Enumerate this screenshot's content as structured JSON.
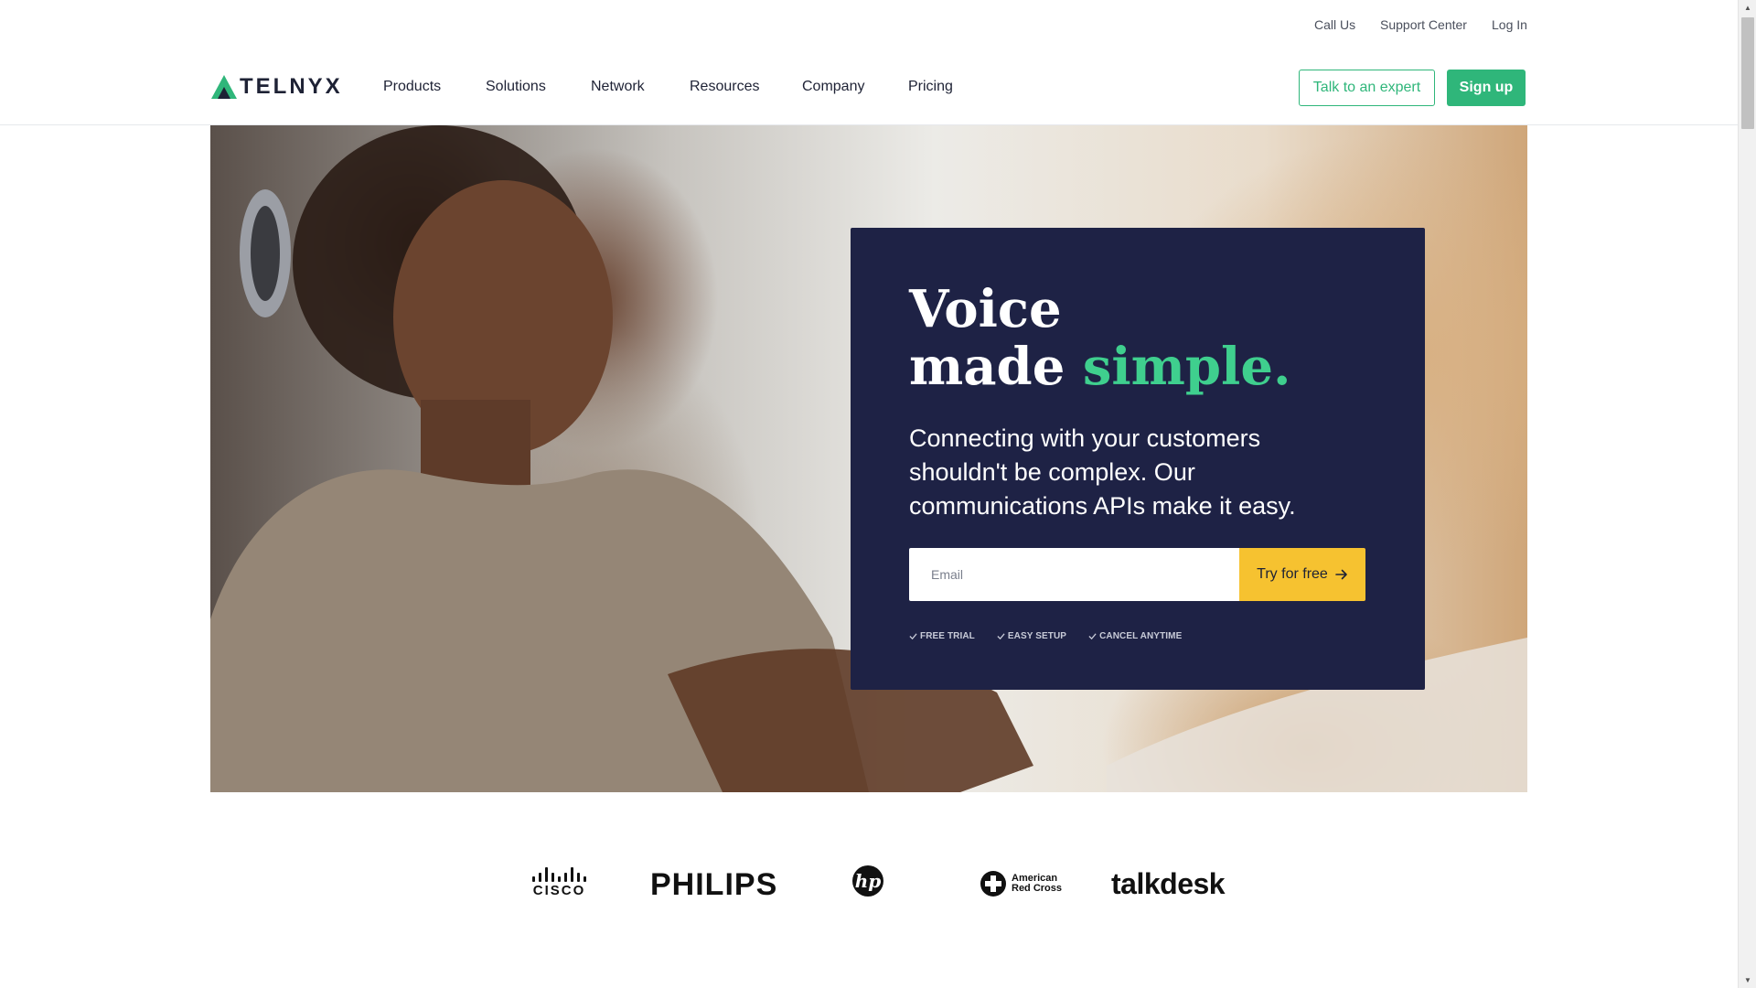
{
  "utility_nav": {
    "call_us": "Call Us",
    "support_center": "Support Center",
    "log_in": "Log In"
  },
  "header": {
    "logo_text": "TELNYX",
    "nav": [
      {
        "label": "Products"
      },
      {
        "label": "Solutions"
      },
      {
        "label": "Network"
      },
      {
        "label": "Resources"
      },
      {
        "label": "Company"
      },
      {
        "label": "Pricing"
      }
    ],
    "talk_to_expert": "Talk to an expert",
    "sign_up": "Sign up"
  },
  "hero": {
    "headline_line1": "Voice",
    "headline_line2_prefix": "made ",
    "headline_line2_accent": "simple.",
    "subtext": "Connecting with your customers shouldn't be complex. Our communications APIs make it easy.",
    "email_placeholder": "Email",
    "cta_label": "Try for free",
    "features": [
      "FREE TRIAL",
      "EASY SETUP",
      "CANCEL ANYTIME"
    ]
  },
  "customer_logos": {
    "cisco": "CISCO",
    "philips": "PHILIPS",
    "hp": "hp",
    "red_cross_line1": "American",
    "red_cross_line2": "Red Cross",
    "talkdesk": "talkdesk"
  },
  "colors": {
    "brand_green": "#2fb67a",
    "accent_green": "#3fcf8e",
    "card_navy": "#1e2245",
    "cta_yellow": "#f6c230"
  },
  "icons": {
    "logo_mark": "telnyx-triangle-icon",
    "cta_arrow": "arrow-right-icon",
    "feature_check": "check-icon",
    "scroll_up": "caret-up-icon",
    "scroll_down": "caret-down-icon"
  }
}
